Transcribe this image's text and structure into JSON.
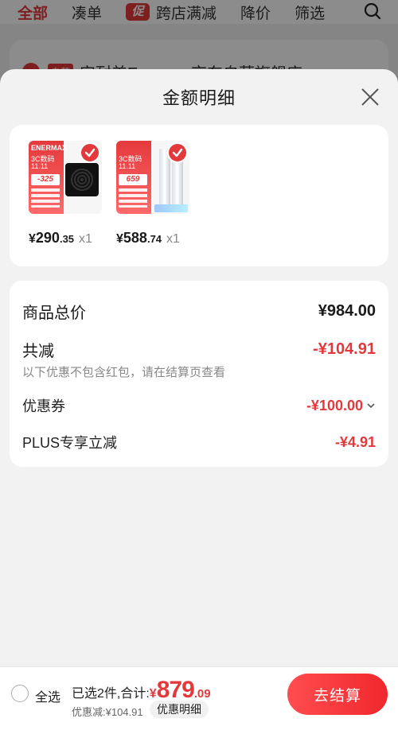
{
  "bg_nav": {
    "tabs": [
      {
        "label": "全部"
      },
      {
        "label": "凑单"
      },
      {
        "label": "跨店满减",
        "badge": "促"
      },
      {
        "label": "降价"
      },
      {
        "label": "筛选"
      }
    ]
  },
  "bg_store": {
    "tag": "自营",
    "name": "安耐美Enermax京东自营旗舰店 >"
  },
  "sheet": {
    "title": "金额明细"
  },
  "products": [
    {
      "brand": "ENERMAX",
      "line1": "3C数码",
      "line2": "11.11",
      "tag_price": "-325",
      "yuan": "¥",
      "int": "290",
      "dec": ".35",
      "qty": "x1"
    },
    {
      "brand": "",
      "line1": "3C数码",
      "line2": "11.11",
      "tag_price": "659",
      "yuan": "¥",
      "int": "588",
      "dec": ".74",
      "qty": "x1"
    }
  ],
  "details": {
    "total_label": "商品总价",
    "total_value": "¥984.00",
    "discount_label": "共减",
    "discount_value": "-¥104.91",
    "note": "以下优惠不包含红包，请在结算页查看",
    "coupon_label": "优惠券",
    "coupon_value": "-¥100.00",
    "plus_label": "PLUS专享立减",
    "plus_value": "-¥4.91"
  },
  "bottom": {
    "select_all": "全选",
    "summary_label": "已选2件,合计:",
    "total_yuan": "¥",
    "total_int": "879",
    "total_dec": ".09",
    "saved": "优惠减:¥104.91",
    "detail_chip": "优惠明细",
    "checkout": "去结算"
  },
  "colors": {
    "accent": "#e4393c",
    "background": "#f2f2f2"
  }
}
